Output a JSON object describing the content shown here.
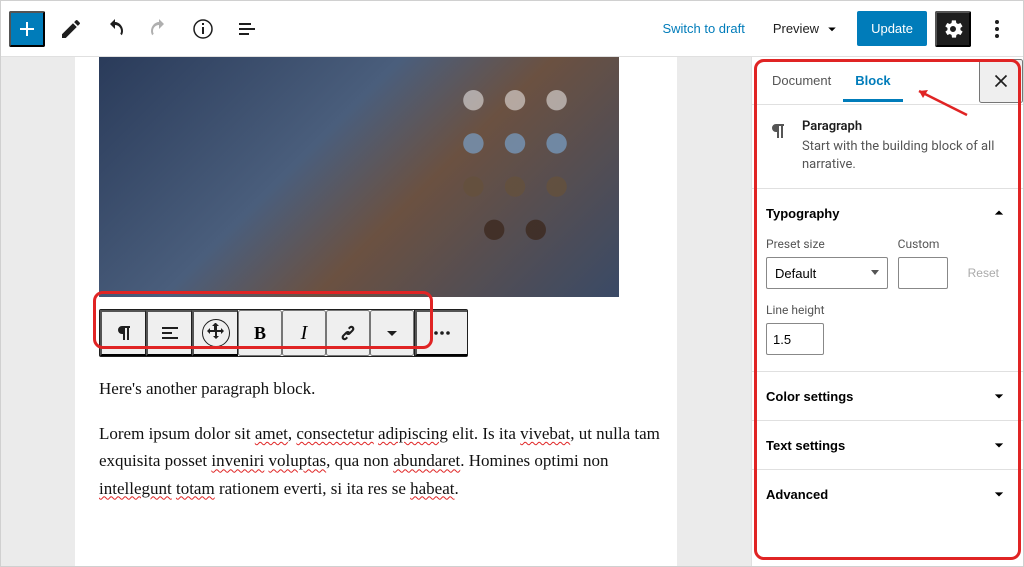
{
  "topbar": {
    "switch_to_draft": "Switch to draft",
    "preview": "Preview",
    "update": "Update"
  },
  "editor": {
    "paragraph1": "Here's another paragraph block.",
    "paragraph2_parts": {
      "p1": "Lorem ipsum dolor sit ",
      "w1": "amet",
      "p2": ", ",
      "w2": "consectetur",
      "p3": " ",
      "w3": "adipiscing",
      "p4": " elit. Is ita ",
      "w4": "vivebat",
      "p5": ", ut nulla tam exquisita posset ",
      "w5": "inveniri",
      "p6": " ",
      "w6": "voluptas",
      "p7": ", qua non ",
      "w7": "abundaret",
      "p8": ". Homines optimi non ",
      "w8": "intellegunt",
      "p9": " ",
      "w9": "totam",
      "p10": " rationem everti, si ita res se ",
      "w10": "habeat",
      "p11": "."
    }
  },
  "sidebar": {
    "tabs": {
      "document": "Document",
      "block": "Block"
    },
    "block_card": {
      "title": "Paragraph",
      "desc": "Start with the building block of all narrative."
    },
    "typography": {
      "title": "Typography",
      "preset_label": "Preset size",
      "preset_value": "Default",
      "custom_label": "Custom",
      "custom_value": "",
      "reset": "Reset",
      "line_height_label": "Line height",
      "line_height_value": "1.5"
    },
    "panels": {
      "color": "Color settings",
      "text": "Text settings",
      "advanced": "Advanced"
    }
  }
}
